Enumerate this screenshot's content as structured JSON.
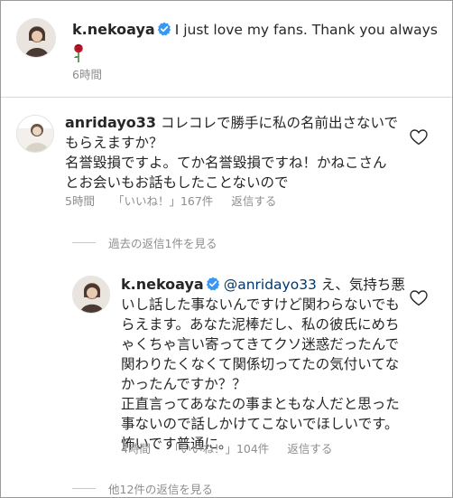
{
  "post": {
    "username": "k.nekoaya",
    "caption": "I just love my fans. Thank you always",
    "emoji": "🌹",
    "time": "6時間"
  },
  "comment": {
    "username": "anridayo33",
    "text_line1": "コレコレで勝手に私の名前出さないで",
    "text_line2": "もらえますか？",
    "text_line3": "名誉毀損ですよ。てか名誉毀損ですね！かねこさん",
    "text_line4": "とお会いもお話もしたことないので",
    "time": "5時間",
    "likes": "「いいね！」167件",
    "reply_label": "返信する",
    "view_replies": "過去の返信1件を見る"
  },
  "reply": {
    "username": "k.nekoaya",
    "mention": "@anridayo33",
    "text_first": " え、気持ち悪",
    "text_line2": "いし話した事ないんですけど関わらないでも",
    "text_line3": "らえます。あなた泥棒だし、私の彼氏にめち",
    "text_line4": "ゃくちゃ言い寄ってきてクソ迷惑だったんで",
    "text_line5": "関わりたくなくて関係切ってたの気付いてな",
    "text_line6": "かったんですか？？",
    "text_line7": "正直言ってあなたの事まともな人だと思った",
    "text_line8": "事ないので話しかけてこないでほしいです。",
    "text_line9": "怖いです普通に。",
    "time": "4時間",
    "likes": "「いいね！」104件",
    "reply_label": "返信する"
  },
  "more_replies": "他12件の返信を見る",
  "colors": {
    "verified": "#3897f0",
    "meta": "#8e8e8e",
    "mention": "#00376b",
    "divider": "#dbdbdb"
  },
  "icons": {
    "verified": "verified-badge-icon",
    "like": "heart-outline-icon",
    "rose": "rose-emoji-icon"
  }
}
